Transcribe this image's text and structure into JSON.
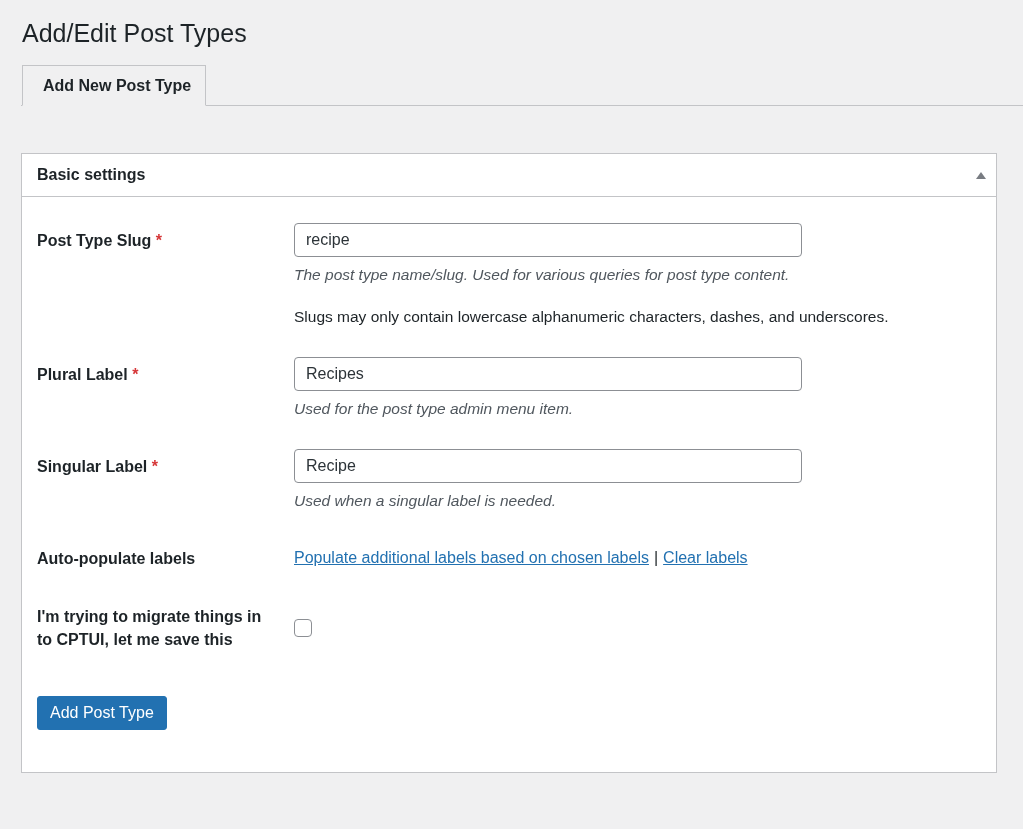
{
  "page_title": "Add/Edit Post Types",
  "tabs": [
    {
      "label": "Add New Post Type",
      "selected": true
    }
  ],
  "panel": {
    "title": "Basic settings",
    "expanded": true,
    "rows": [
      {
        "kind": "text",
        "label": "Post Type Slug",
        "required_mark": "*",
        "value": "recipe",
        "description": "The post type name/slug. Used for various queries for post type content.",
        "note": "Slugs may only contain lowercase alphanumeric characters, dashes, and underscores."
      },
      {
        "kind": "text",
        "label": "Plural Label",
        "required_mark": "*",
        "value": "Recipes",
        "description": "Used for the post type admin menu item."
      },
      {
        "kind": "text",
        "label": "Singular Label",
        "required_mark": "*",
        "value": "Recipe",
        "description": "Used when a singular label is needed."
      },
      {
        "kind": "links",
        "label": "Auto-populate labels",
        "links": [
          "Populate additional labels based on chosen labels",
          "Clear labels"
        ],
        "separator": "|"
      },
      {
        "kind": "checkbox",
        "label": "I'm trying to migrate things in to CPTUI, let me save this",
        "checked": false
      }
    ],
    "button": "Add Post Type"
  }
}
